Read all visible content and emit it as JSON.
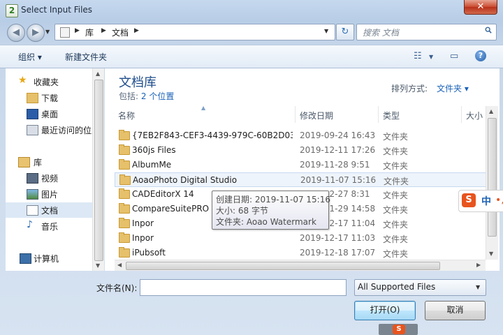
{
  "window": {
    "title": "Select Input Files",
    "app_icon_glyph": "2",
    "close_glyph": "✕"
  },
  "address": {
    "crumbs": [
      "库",
      "文档"
    ],
    "search_placeholder": "搜索 文档"
  },
  "toolbar": {
    "organize": "组织 ▾",
    "new_folder": "新建文件夹"
  },
  "nav": {
    "items": [
      {
        "label": "收藏夹",
        "icon": "star-icon"
      },
      {
        "label": "下载",
        "icon": "download-folder-icon"
      },
      {
        "label": "桌面",
        "icon": "desktop-icon"
      },
      {
        "label": "最近访问的位置",
        "icon": "recent-places-icon"
      },
      {
        "label": "库",
        "icon": "library-icon"
      },
      {
        "label": "视频",
        "icon": "video-library-icon"
      },
      {
        "label": "图片",
        "icon": "picture-library-icon"
      },
      {
        "label": "文档",
        "icon": "document-library-icon"
      },
      {
        "label": "音乐",
        "icon": "music-library-icon"
      },
      {
        "label": "计算机",
        "icon": "computer-icon"
      }
    ],
    "selected": "文档"
  },
  "library": {
    "title": "文档库",
    "includes_label": "包括:",
    "includes_link": "2 个位置",
    "arrange_label": "排列方式:",
    "arrange_value": "文件夹 ▾"
  },
  "columns": {
    "name": "名称",
    "date": "修改日期",
    "type": "类型",
    "size": "大小"
  },
  "rows": [
    {
      "name": "{7EB2F843-CEF3-4439-979C-60B2D03...",
      "date": "2019-09-24 16:43",
      "type": "文件夹"
    },
    {
      "name": "360js Files",
      "date": "2019-12-11 17:26",
      "type": "文件夹"
    },
    {
      "name": "AlbumMe",
      "date": "2019-11-28 9:51",
      "type": "文件夹"
    },
    {
      "name": "AoaoPhoto Digital Studio",
      "date": "2019-11-07 15:16",
      "type": "文件夹"
    },
    {
      "name": "CADEditorX 14",
      "date": "2019-12-27 8:31",
      "type": "文件夹"
    },
    {
      "name": "CompareSuitePRO",
      "date": "2019-11-29 14:58",
      "type": "文件夹"
    },
    {
      "name": "Inpor",
      "date": "2019-12-17 11:04",
      "type": "文件夹"
    },
    {
      "name": "Inpor",
      "date": "2019-12-17 11:03",
      "type": "文件夹"
    },
    {
      "name": "iPubsoft",
      "date": "2019-12-18 17:07",
      "type": "文件夹"
    }
  ],
  "tooltip": {
    "created": "创建日期: 2019-11-07 15:16",
    "size": "大小: 68 字节",
    "folders": "文件夹: Aoao Watermark"
  },
  "ime": {
    "logo": "S",
    "mode": "中",
    "punct": "•,"
  },
  "bottom": {
    "filename_label": "文件名(N):",
    "filename_value": "",
    "filter": "All Supported Files",
    "open": "打开(O)",
    "cancel": "取消"
  }
}
